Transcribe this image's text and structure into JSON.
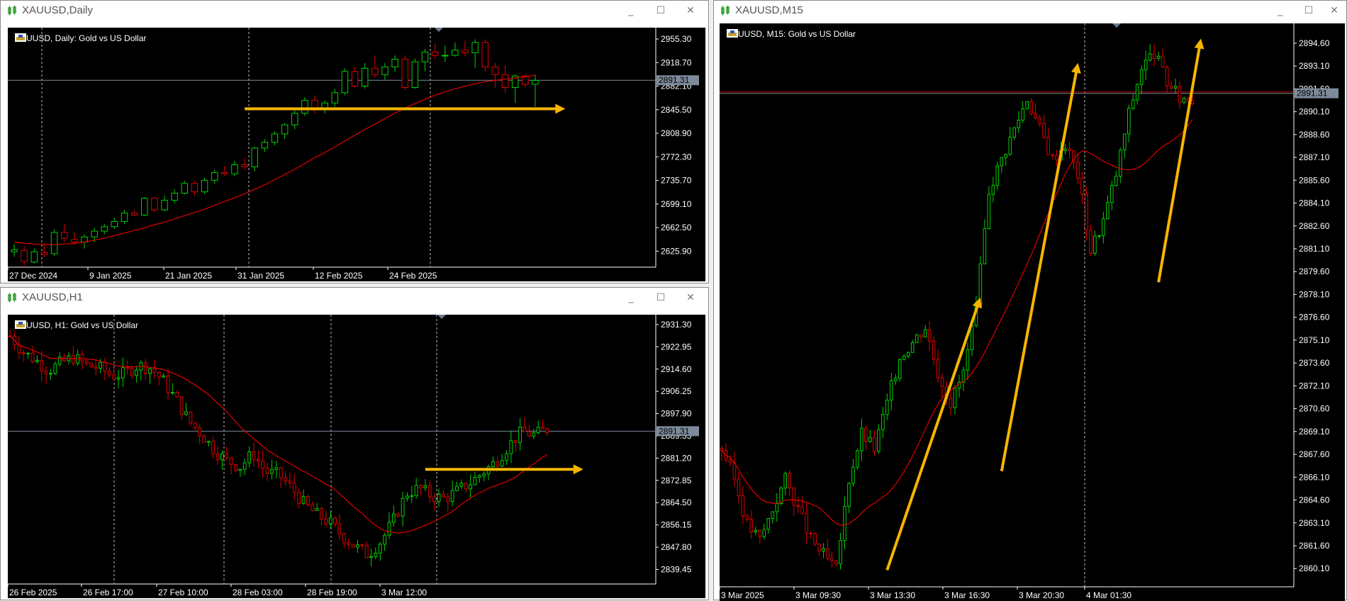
{
  "colors": {
    "bg": "#000000",
    "bull": "#00d000",
    "bear": "#e00000",
    "ma": "#e00000",
    "arrow": "#f7b500",
    "axis_text": "#ffffff",
    "price_line": "#7c8a9a",
    "price_tag_bg": "#7c8a9a"
  },
  "windows": {
    "daily": {
      "title": "XAUUSD,Daily",
      "label": "XAUUSD, Daily:  Gold vs US Dollar",
      "icons": [
        "chart-candle-icon",
        "minimize-icon",
        "maximize-icon",
        "close-icon"
      ]
    },
    "h1": {
      "title": "XAUUSD,H1",
      "label": "XAUUSD, H1:  Gold vs US Dollar"
    },
    "m15": {
      "title": "XAUUSD,M15",
      "label": "XAUUSD, M15:  Gold vs US Dollar"
    }
  },
  "controls": {
    "minimize": "_",
    "maximize": "☐",
    "close": "✕"
  },
  "chart_data": [
    {
      "id": "daily",
      "type": "candlestick",
      "title": "XAUUSD, Daily:  Gold vs US Dollar",
      "y_ticks": [
        "2955.30",
        "2918.70",
        "2882.10",
        "2845.50",
        "2808.90",
        "2772.30",
        "2735.70",
        "2699.10",
        "2662.50",
        "2625.90"
      ],
      "y_tick_values": [
        2955.3,
        2918.7,
        2882.1,
        2845.5,
        2808.9,
        2772.3,
        2735.7,
        2699.1,
        2662.5,
        2625.9
      ],
      "ylim": [
        2601,
        2973
      ],
      "x_labels": [
        "27 Dec 2024",
        "9 Jan 2025",
        "21 Jan 2025",
        "31 Jan 2025",
        "12 Feb 2025",
        "24 Feb 2025"
      ],
      "x_label_index": [
        0,
        9,
        17,
        25,
        34,
        42
      ],
      "current_price": "2891.31",
      "current_value": 2891.31,
      "candles": [
        [
          2625,
          2637,
          2617,
          2628
        ],
        [
          2627,
          2633,
          2604,
          2610
        ],
        [
          2609,
          2630,
          2607,
          2625
        ],
        [
          2624,
          2638,
          2617,
          2621
        ],
        [
          2622,
          2660,
          2618,
          2655
        ],
        [
          2655,
          2668,
          2640,
          2646
        ],
        [
          2644,
          2655,
          2636,
          2640
        ],
        [
          2640,
          2652,
          2630,
          2648
        ],
        [
          2648,
          2662,
          2640,
          2657
        ],
        [
          2657,
          2668,
          2652,
          2664
        ],
        [
          2664,
          2678,
          2660,
          2672
        ],
        [
          2672,
          2690,
          2668,
          2685
        ],
        [
          2685,
          2690,
          2680,
          2682
        ],
        [
          2682,
          2710,
          2680,
          2708
        ],
        [
          2708,
          2710,
          2686,
          2690
        ],
        [
          2690,
          2712,
          2688,
          2705
        ],
        [
          2705,
          2722,
          2700,
          2716
        ],
        [
          2716,
          2735,
          2714,
          2731
        ],
        [
          2731,
          2735,
          2712,
          2718
        ],
        [
          2718,
          2740,
          2715,
          2736
        ],
        [
          2736,
          2752,
          2730,
          2748
        ],
        [
          2748,
          2758,
          2742,
          2746
        ],
        [
          2746,
          2766,
          2742,
          2760
        ],
        [
          2760,
          2770,
          2752,
          2757
        ],
        [
          2757,
          2788,
          2750,
          2786
        ],
        [
          2786,
          2800,
          2780,
          2795
        ],
        [
          2795,
          2812,
          2790,
          2808
        ],
        [
          2808,
          2825,
          2800,
          2822
        ],
        [
          2822,
          2845,
          2815,
          2840
        ],
        [
          2840,
          2865,
          2836,
          2860
        ],
        [
          2860,
          2868,
          2840,
          2846
        ],
        [
          2846,
          2860,
          2840,
          2856
        ],
        [
          2856,
          2878,
          2850,
          2872
        ],
        [
          2872,
          2910,
          2868,
          2905
        ],
        [
          2905,
          2912,
          2880,
          2882
        ],
        [
          2882,
          2918,
          2878,
          2910
        ],
        [
          2910,
          2930,
          2895,
          2900
        ],
        [
          2900,
          2918,
          2892,
          2912
        ],
        [
          2912,
          2930,
          2905,
          2924
        ],
        [
          2924,
          2930,
          2876,
          2880
        ],
        [
          2880,
          2925,
          2878,
          2920
        ],
        [
          2920,
          2940,
          2905,
          2935
        ],
        [
          2935,
          2948,
          2925,
          2930
        ],
        [
          2930,
          2945,
          2920,
          2930
        ],
        [
          2930,
          2950,
          2928,
          2938
        ],
        [
          2938,
          2953,
          2928,
          2934
        ],
        [
          2934,
          2955,
          2910,
          2950
        ],
        [
          2950,
          2955,
          2905,
          2912
        ],
        [
          2912,
          2918,
          2880,
          2900
        ],
        [
          2900,
          2914,
          2872,
          2880
        ],
        [
          2880,
          2900,
          2856,
          2898
        ],
        [
          2898,
          2900,
          2880,
          2885
        ],
        [
          2885,
          2900,
          2850,
          2891
        ]
      ],
      "ma": [
        2640,
        2638,
        2637,
        2636,
        2636,
        2637,
        2638,
        2640,
        2643,
        2646,
        2650,
        2654,
        2658,
        2662,
        2667,
        2671,
        2676,
        2681,
        2686,
        2691,
        2697,
        2703,
        2709,
        2715,
        2722,
        2729,
        2737,
        2745,
        2753,
        2762,
        2771,
        2779,
        2788,
        2797,
        2806,
        2815,
        2823,
        2832,
        2840,
        2848,
        2855,
        2862,
        2868,
        2873,
        2878,
        2882,
        2886,
        2889,
        2891,
        2893,
        2895,
        2897,
        2899
      ],
      "arrows": [
        {
          "from": [
            23,
            2847
          ],
          "to": [
            55,
            2847
          ]
        }
      ]
    },
    {
      "id": "h1",
      "type": "candlestick",
      "title": "XAUUSD, H1:  Gold vs US Dollar",
      "y_ticks": [
        "2931.30",
        "2922.95",
        "2914.60",
        "2906.25",
        "2897.90",
        "2889.55",
        "2881.20",
        "2872.85",
        "2864.50",
        "2856.15",
        "2847.80",
        "2839.45"
      ],
      "y_tick_values": [
        2931.3,
        2922.95,
        2914.6,
        2906.25,
        2897.9,
        2889.55,
        2881.2,
        2872.85,
        2864.5,
        2856.15,
        2847.8,
        2839.45
      ],
      "ylim": [
        2834,
        2935
      ],
      "x_labels": [
        "26 Feb 2025",
        "26 Feb 17:00",
        "27 Feb 10:00",
        "28 Feb 03:00",
        "28 Feb 19:00",
        "3 Mar 12:00"
      ],
      "current_price": "2891.31",
      "current_value": 2891.31,
      "ohlc_seed": "h1",
      "arrows": [
        {
          "from": [
            92,
            2877
          ],
          "to": [
            127,
            2877
          ]
        }
      ]
    },
    {
      "id": "m15",
      "type": "candlestick",
      "title": "XAUUSD, M15:  Gold vs US Dollar",
      "y_ticks": [
        "2894.60",
        "2893.10",
        "2891.60",
        "2890.10",
        "2888.60",
        "2887.10",
        "2885.60",
        "2884.10",
        "2882.60",
        "2881.10",
        "2879.60",
        "2878.10",
        "2876.60",
        "2875.10",
        "2873.60",
        "2872.10",
        "2870.60",
        "2869.10",
        "2867.60",
        "2866.10",
        "2864.60",
        "2863.10",
        "2861.60",
        "2860.10"
      ],
      "y_tick_values": [
        2894.6,
        2893.1,
        2891.6,
        2890.1,
        2888.6,
        2887.1,
        2885.6,
        2884.1,
        2882.6,
        2881.1,
        2879.6,
        2878.1,
        2876.6,
        2875.1,
        2873.6,
        2872.1,
        2870.6,
        2869.1,
        2867.6,
        2866.1,
        2864.6,
        2863.1,
        2861.6,
        2860.1
      ],
      "ylim": [
        2858.9,
        2895.9
      ],
      "x_labels": [
        "3 Mar 2025",
        "3 Mar 09:30",
        "3 Mar 13:30",
        "3 Mar 16:30",
        "3 Mar 20:30",
        "4 Mar 01:30"
      ],
      "current_price": "2891.31",
      "current_value": 2891.31,
      "arrows": [
        {
          "from": [
            39,
            2860
          ],
          "to": [
            61,
            2877.9
          ]
        },
        {
          "from": [
            66,
            2866.5
          ],
          "to": [
            84,
            2893.3
          ]
        },
        {
          "from": [
            103,
            2878.9
          ],
          "to": [
            113,
            2894.9
          ]
        }
      ]
    }
  ]
}
